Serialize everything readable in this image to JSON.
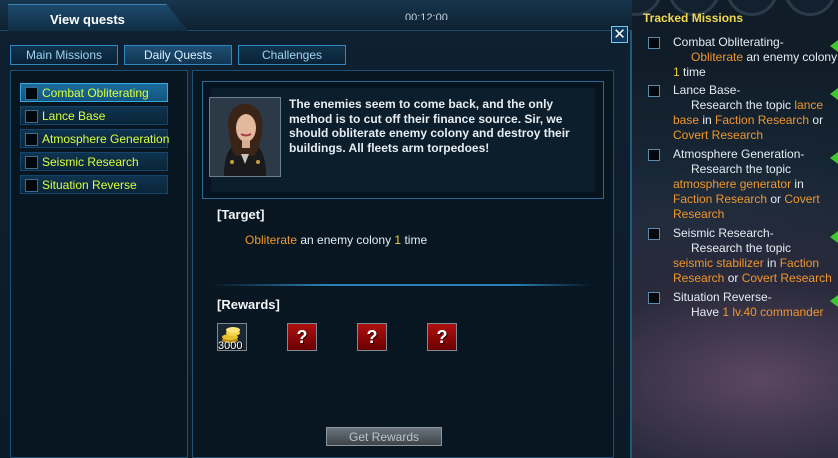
{
  "window": {
    "title": "View quests",
    "clock": "00:12:00",
    "close_label": "✕"
  },
  "tabs": [
    {
      "label": "Main Missions"
    },
    {
      "label": "Daily Quests"
    },
    {
      "label": "Challenges"
    }
  ],
  "missions": [
    {
      "label": "Combat Obliterating",
      "selected": true
    },
    {
      "label": "Lance Base"
    },
    {
      "label": "Atmosphere Generation"
    },
    {
      "label": "Seismic Research"
    },
    {
      "label": "Situation Reverse"
    }
  ],
  "detail": {
    "story": "The enemies seem to come back, and the only method is to cut off their finance source. Sir, we should obliterate enemy colony and destroy their buildings. All fleets arm torpedoes!",
    "target_heading": "[Target]",
    "objective": {
      "pre": "Obliterate",
      "mid": " an enemy colony ",
      "count": "1",
      "post": " time"
    },
    "rewards_heading": "[Rewards]",
    "rewards": [
      {
        "icon": "gold-coins-icon",
        "amount": "3000"
      },
      {
        "icon": "unknown-reward-icon",
        "symbol": "?"
      },
      {
        "icon": "unknown-reward-icon",
        "symbol": "?"
      },
      {
        "icon": "unknown-reward-icon",
        "symbol": "?"
      }
    ],
    "get_rewards_label": "Get Rewards"
  },
  "tracked": {
    "title": "Tracked Missions",
    "items": [
      {
        "head": "Combat Obliterating-",
        "l1a": "Obliterate",
        "l1b": " an enemy colony",
        "l2a": "1",
        "l2b": " time"
      },
      {
        "head": "Lance Base-",
        "l1": "Research the topic ",
        "l1o": "lance",
        "l2o": "base",
        "l2": " in ",
        "l2p": "Faction Research",
        "l2q": " or",
        "l3": "Covert Research"
      },
      {
        "head": "Atmosphere Generation-",
        "l1": "Research the topic",
        "l2o": "atmosphere generator",
        "l2": " in",
        "l3o": "Faction Research",
        "l3": " or ",
        "l3p": "Covert",
        "l4": "Research"
      },
      {
        "head": "Seismic Research-",
        "l1": "Research the topic",
        "l2o": "seismic stabilizer",
        "l2": " in ",
        "l2p": "Faction",
        "l3o": "Research",
        "l3": " or ",
        "l3p": "Covert Research"
      },
      {
        "head": "Situation Reverse-",
        "l1": "Have ",
        "l1o": "1 lv.40 commander"
      }
    ]
  },
  "colors": {
    "accent": "#2f88c2",
    "mission_text": "#d9ff3e",
    "highlight": "#f09a2a",
    "tracked_title": "#f0d850"
  }
}
